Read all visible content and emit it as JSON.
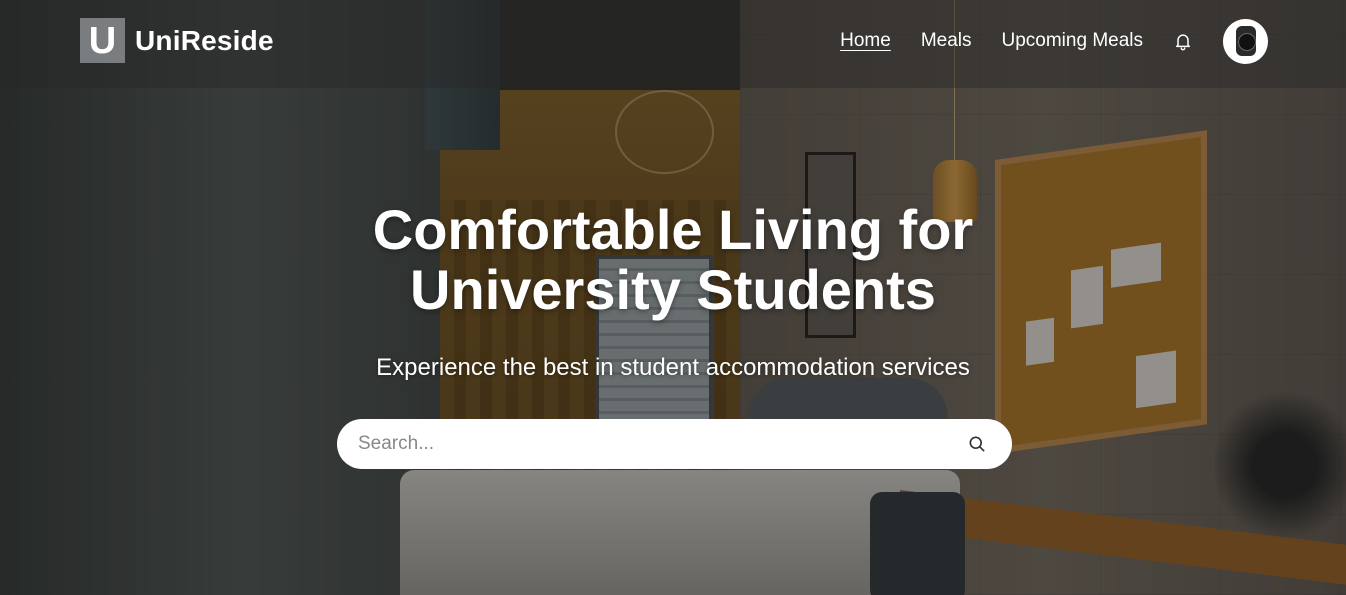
{
  "brand": {
    "logo_letter": "U",
    "name": "UniReside"
  },
  "nav": {
    "items": [
      {
        "label": "Home",
        "active": true
      },
      {
        "label": "Meals",
        "active": false
      },
      {
        "label": "Upcoming Meals",
        "active": false
      }
    ],
    "notification_icon": "bell-icon",
    "avatar_icon": "watch-avatar"
  },
  "hero": {
    "title": "Comfortable Living for University Students",
    "subtitle": "Experience the best in student accommodation services"
  },
  "search": {
    "placeholder": "Search...",
    "value": "",
    "icon": "search-icon"
  },
  "colors": {
    "navbar_bg": "#282828",
    "text": "#ffffff",
    "search_bg": "#ffffff",
    "logo_bg": "#7a7d7f"
  }
}
